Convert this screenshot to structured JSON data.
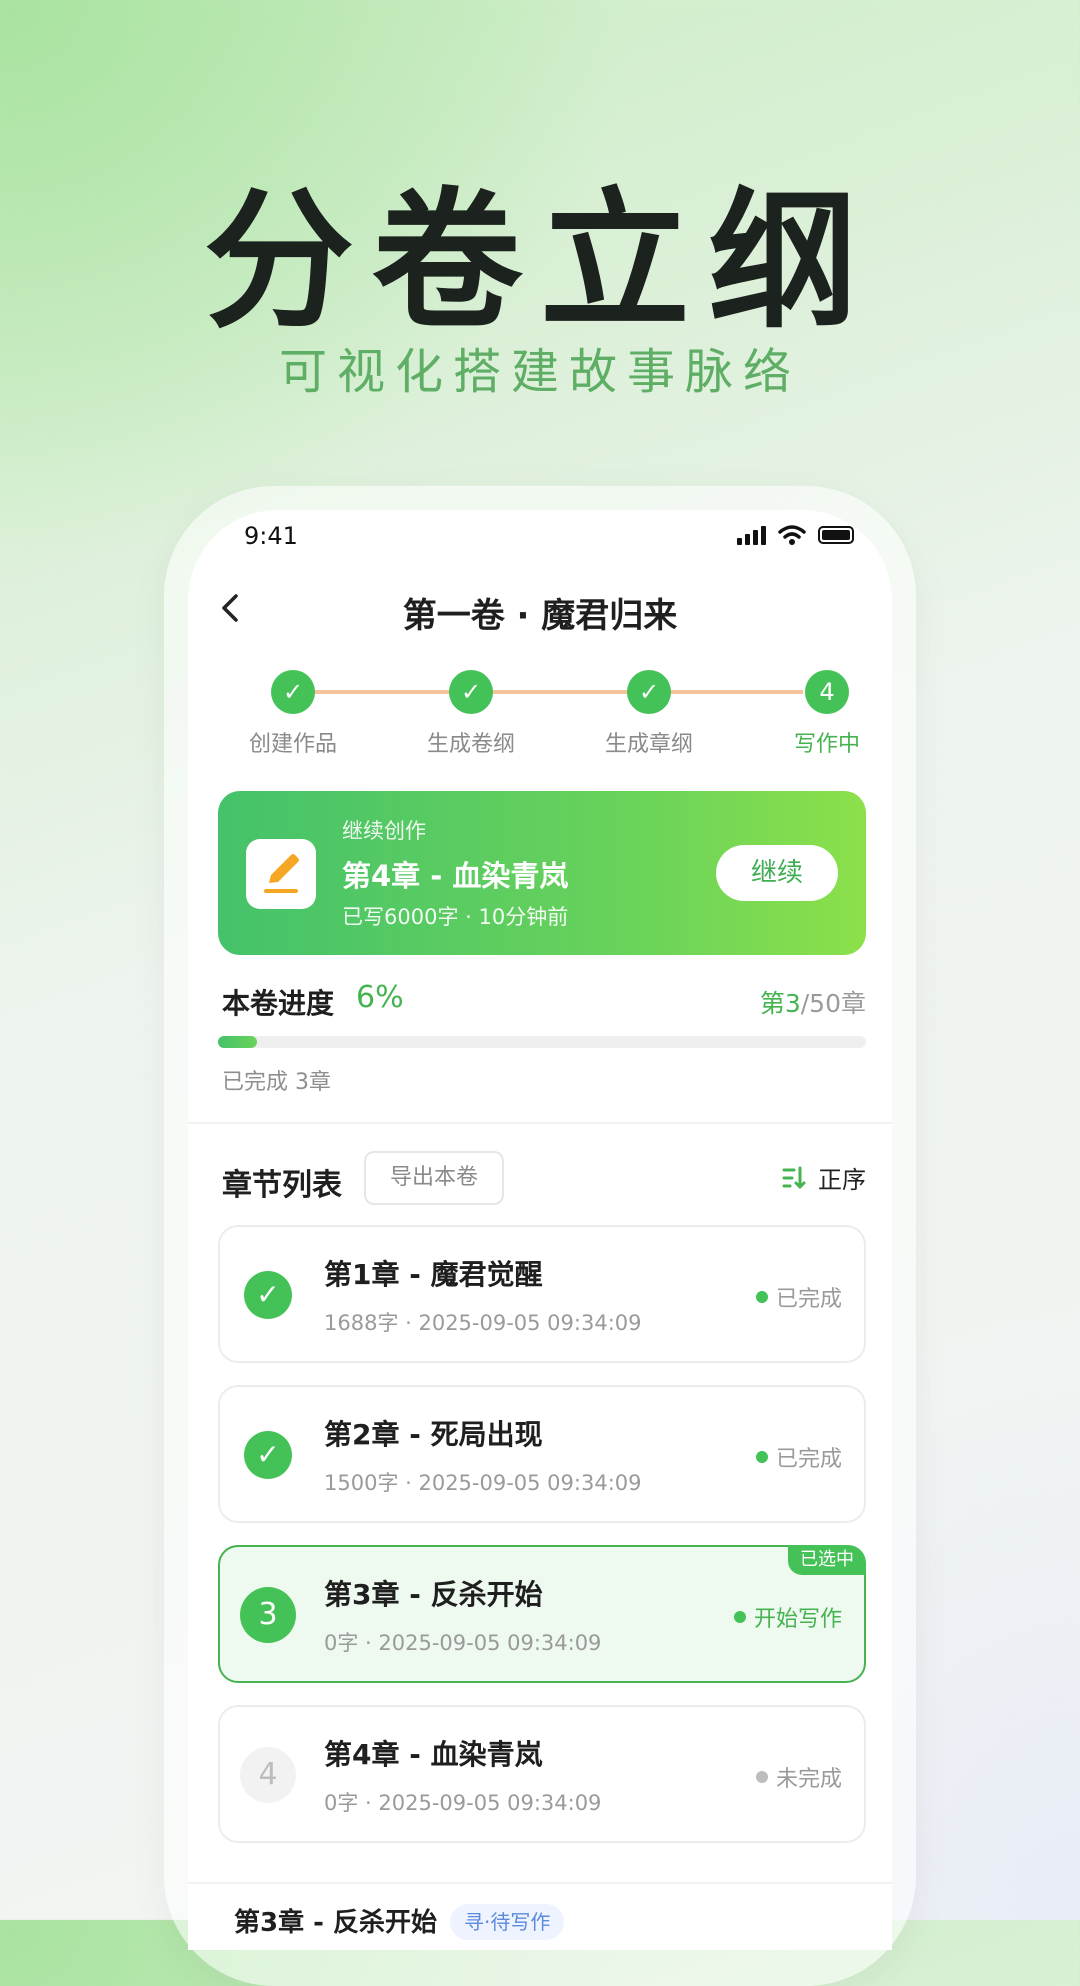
{
  "hero": {
    "title": "分卷立纲",
    "subtitle": "可视化搭建故事脉络"
  },
  "status_bar": {
    "time": "9:41",
    "icons": [
      "signal-icon",
      "wifi-icon",
      "battery-icon"
    ]
  },
  "nav": {
    "back_icon": "chevron-left-icon",
    "title": "第一卷 · 魔君归来"
  },
  "steps": [
    {
      "label": "创建作品",
      "state": "done"
    },
    {
      "label": "生成卷纲",
      "state": "done"
    },
    {
      "label": "生成章纲",
      "state": "done"
    },
    {
      "label": "写作中",
      "number": "4",
      "state": "active"
    }
  ],
  "continue_card": {
    "kicker": "继续创作",
    "title": "第4章 - 血染青岚",
    "meta": "已写6000字 · 10分钟前",
    "button": "继续",
    "icon": "pencil-icon"
  },
  "progress": {
    "label": "本卷进度",
    "percent_text": "6%",
    "percent_value": 0.06,
    "current_chapter": "第3",
    "total_chapters": "/50章",
    "done_text": "已完成 3章"
  },
  "chapter_list": {
    "title": "章节列表",
    "export_button": "导出本卷",
    "sort_label": "正序",
    "sort_icon": "sort-icon",
    "items": [
      {
        "badge": "✓",
        "title": "第1章 - 魔君觉醒",
        "meta": "1688字 · 2025-09-05  09:34:09",
        "status": "已完成",
        "state": "done"
      },
      {
        "badge": "✓",
        "title": "第2章 - 死局出现",
        "meta": "1500字 · 2025-09-05  09:34:09",
        "status": "已完成",
        "state": "done"
      },
      {
        "badge": "3",
        "title": "第3章 - 反杀开始",
        "meta": "0字 · 2025-09-05  09:34:09",
        "status": "开始写作",
        "state": "current",
        "tag": "已选中"
      },
      {
        "badge": "4",
        "title": "第4章 - 血染青岚",
        "meta": "0字 · 2025-09-05  09:34:09",
        "status": "未完成",
        "state": "todo"
      }
    ]
  },
  "partial_row": {
    "title": "第3章 - 反杀开始",
    "tag": "寻·待写作"
  },
  "colors": {
    "accent": "#45c257",
    "accent_text": "#45b34f",
    "step_line": "#f3c39c",
    "card_gradient_start": "#45c26a",
    "card_gradient_end": "#8ce04a"
  }
}
